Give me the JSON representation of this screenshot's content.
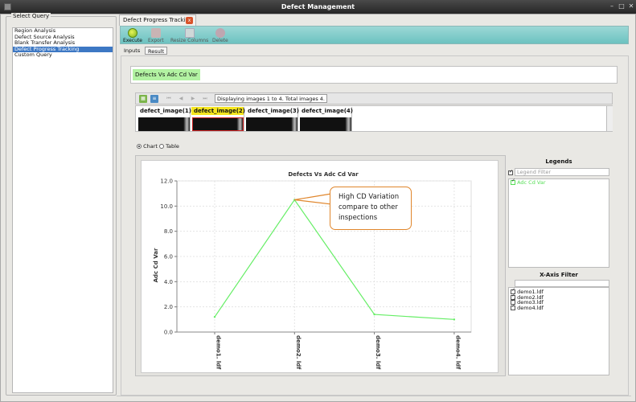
{
  "window": {
    "title": "Defect Management",
    "controls": [
      "–",
      "□",
      "✕"
    ]
  },
  "left_panel": {
    "title": "Select Query",
    "items": [
      {
        "label": "Region Analysis",
        "selected": false
      },
      {
        "label": "Defect Source Analysis",
        "selected": false
      },
      {
        "label": "Blank Transfer Analysis",
        "selected": false
      },
      {
        "label": "Defect Progress Tracking",
        "selected": true
      },
      {
        "label": "Custom Query",
        "selected": false
      }
    ]
  },
  "tab": {
    "label": "Defect Progress Tracking",
    "close": "x"
  },
  "toolbar": {
    "execute_label": "Execute",
    "export_label": "Export",
    "resize_label": "Resize Columns",
    "delete_label": "Delete"
  },
  "subtabs": {
    "inputs": "Inputs",
    "result": "Result"
  },
  "query_chip": "Defects Vs Adc Cd Var",
  "viewer": {
    "status": "Displaying images 1 to 4. Total images 4.",
    "images": [
      {
        "label": "defect_image(1)",
        "selected": false
      },
      {
        "label": "defect_image(2)",
        "selected": true
      },
      {
        "label": "defect_image(3)",
        "selected": false
      },
      {
        "label": "defect_image(4)",
        "selected": false
      }
    ]
  },
  "view_mode": {
    "chart": "Chart",
    "table": "Table"
  },
  "callout": {
    "text": "High CD Variation compare to other inspections"
  },
  "legends": {
    "title": "Legends",
    "filter_placeholder": "Legend Filter",
    "entries": [
      {
        "label": "Adc Cd Var",
        "color": "#66ee66"
      }
    ]
  },
  "x_axis_filter": {
    "title": "X-Axis Filter",
    "items": [
      "demo1.ldf",
      "demo2.ldf",
      "demo3.ldf",
      "demo4.ldf"
    ]
  },
  "chart_data": {
    "type": "line",
    "title": "Defects Vs Adc Cd Var",
    "xlabel": "",
    "ylabel": "Adc Cd Var",
    "categories": [
      "demo1. ldf",
      "demo2. ldf",
      "demo3. ldf",
      "demo4. ldf"
    ],
    "series": [
      {
        "name": "Adc Cd Var",
        "values": [
          1.2,
          10.5,
          1.4,
          1.0
        ],
        "color": "#66ee66"
      }
    ],
    "ylim": [
      0,
      12
    ],
    "yticks": [
      "0.0",
      "2.0",
      "4.0",
      "6.0",
      "8.0",
      "10.0",
      "12.0"
    ],
    "grid": true,
    "legend": "right"
  }
}
